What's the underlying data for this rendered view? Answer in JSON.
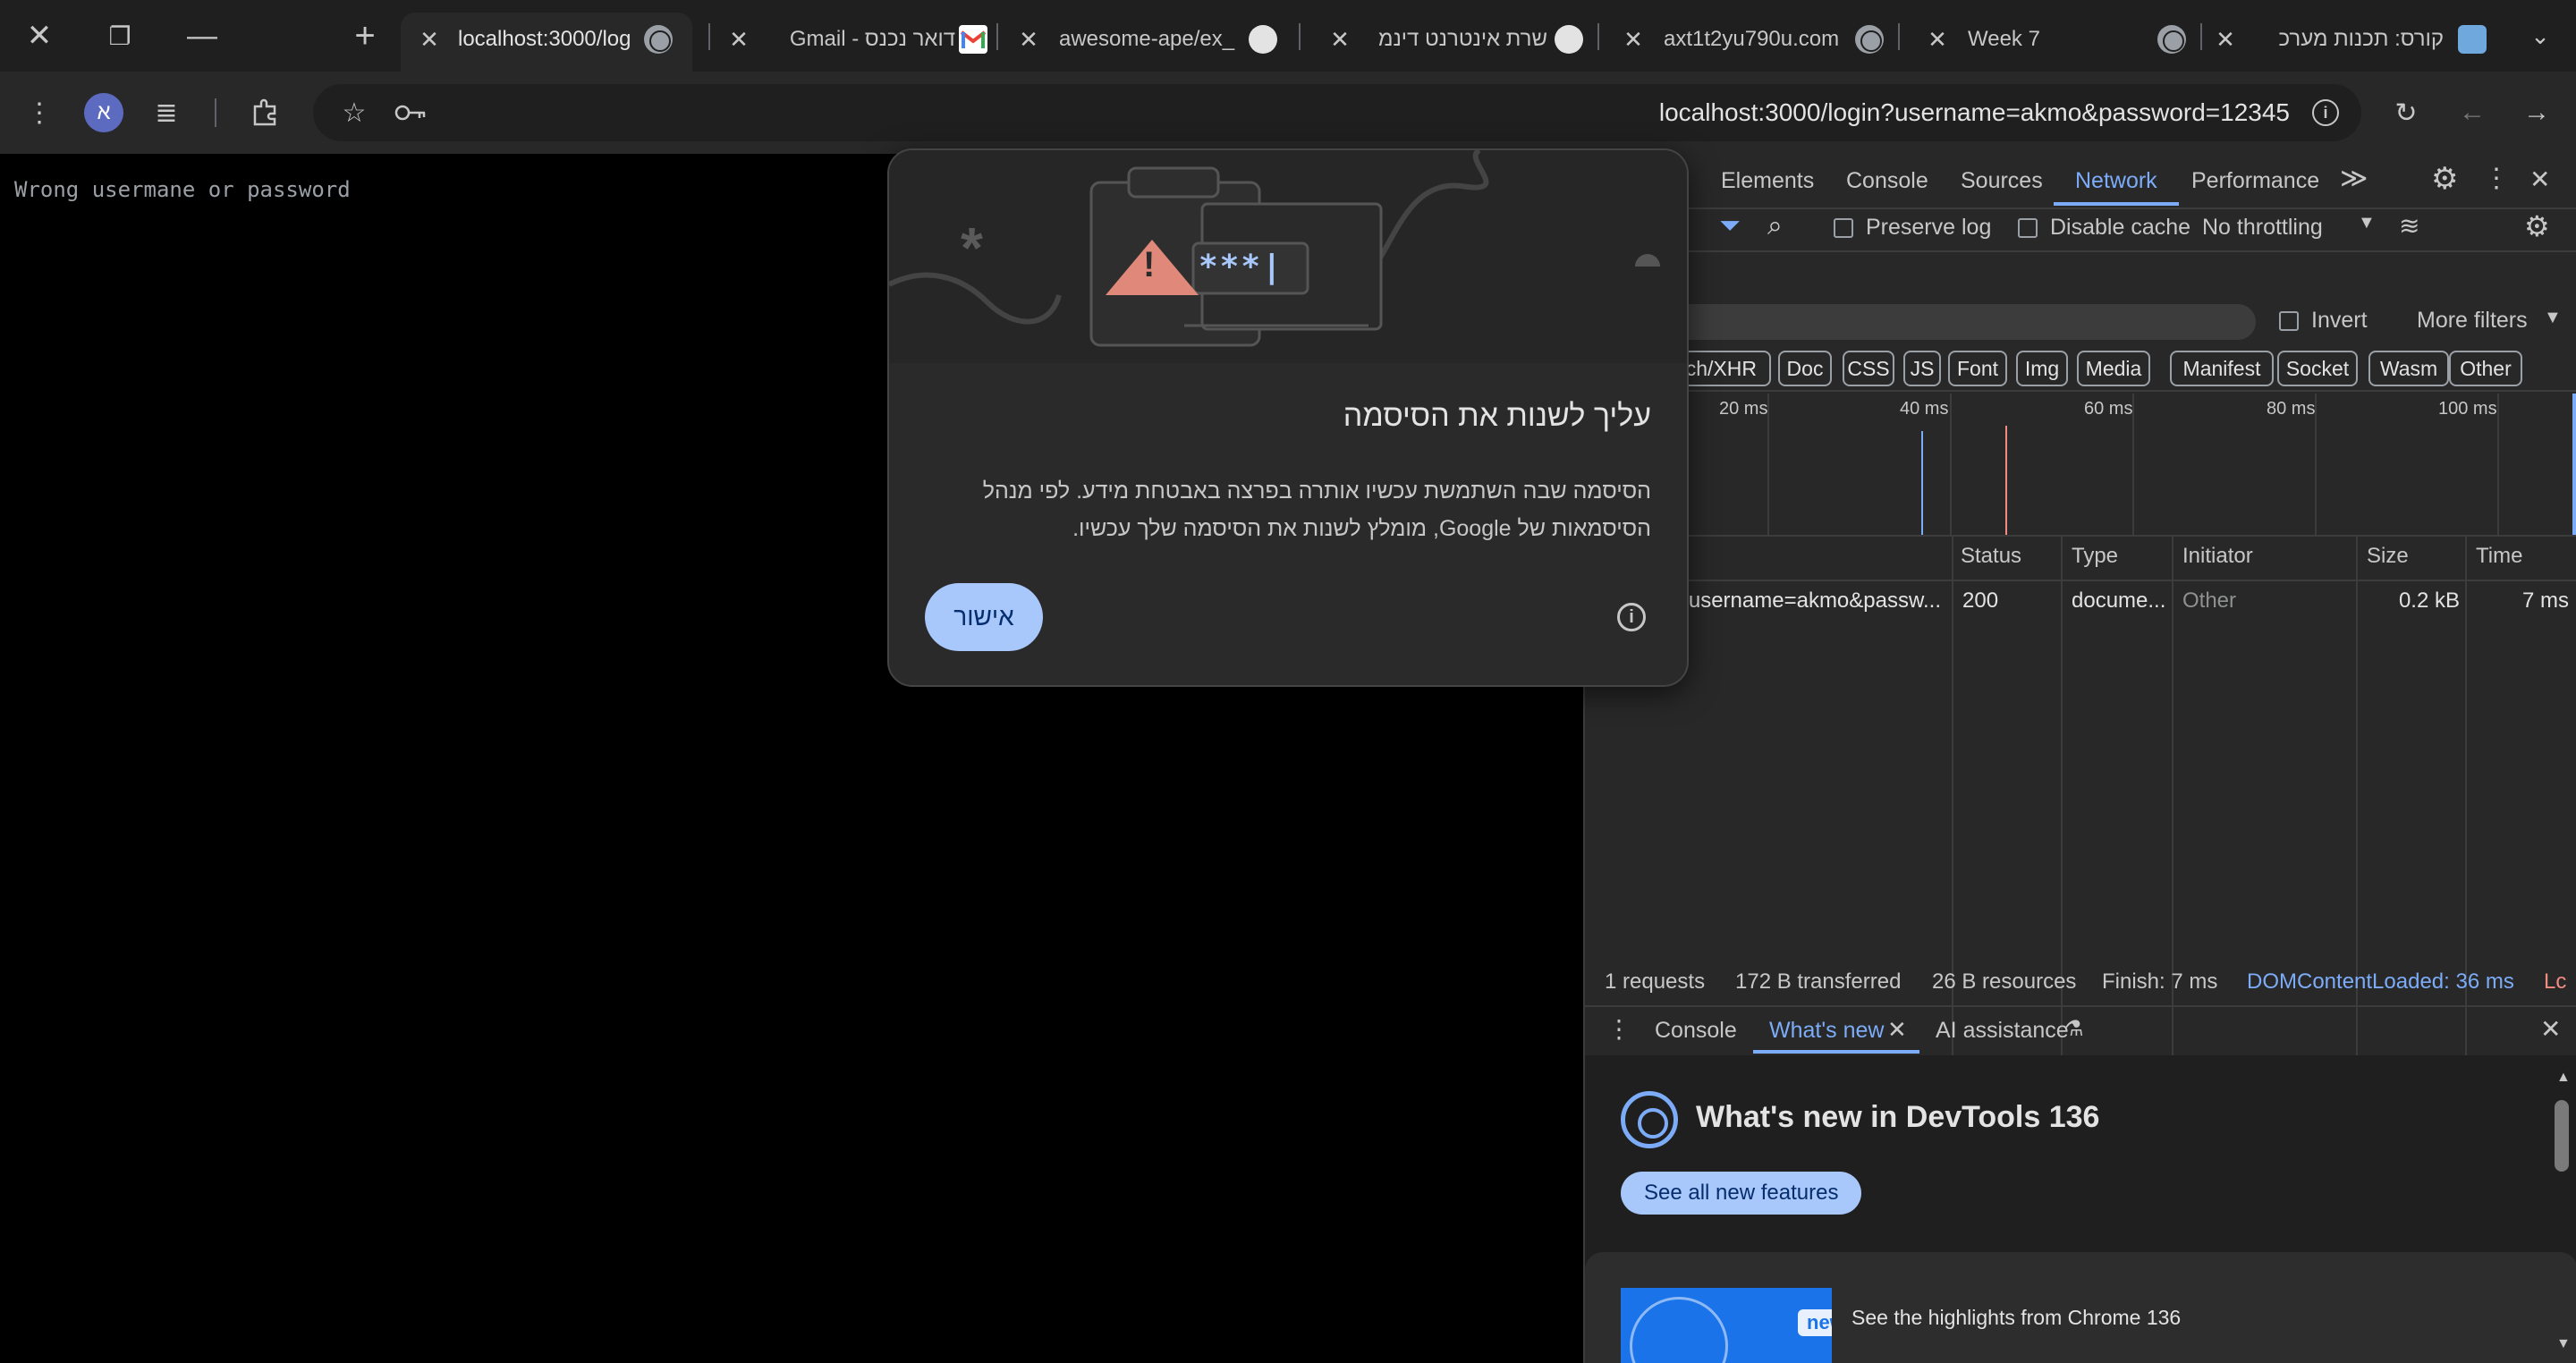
{
  "window": {
    "close_glyph": "✕",
    "restore_glyph": "❐",
    "minimize_glyph": "—",
    "new_tab_glyph": "+"
  },
  "tabs": [
    {
      "title": "localhost:3000/log",
      "icon": "globe-icon",
      "active": true
    },
    {
      "title": "דואר נכנס - Gmail",
      "icon": "gmail-icon"
    },
    {
      "title": "awesome-ape/ex_",
      "icon": "github-icon"
    },
    {
      "title": "שרת אינטרנט דינמ",
      "icon": "chatgpt-icon"
    },
    {
      "title": "axt1t2yu790u.com",
      "icon": "globe-icon"
    },
    {
      "title": "Week 7",
      "icon": "globe-icon"
    },
    {
      "title": "קורס: תכנות מערכ",
      "icon": "course-icon"
    }
  ],
  "toolbar": {
    "avatar_letter": "א",
    "url": "localhost:3000/login?username=akmo&password=12345"
  },
  "page": {
    "error_message": "Wrong usermane or password"
  },
  "dialog": {
    "title": "עליך לשנות את הסיסמה",
    "body": "הסיסמה שבה השתמשת עכשיו אותרה בפרצה באבטחת מידע. לפי מנהל הסיסמאות של Google, מומלץ לשנות את הסיסמה שלך עכשיו.",
    "ok_label": "אישור",
    "illus_password": "***|",
    "illus_warning": "!",
    "illus_star": "*"
  },
  "devtools": {
    "tabs": [
      "Elements",
      "Console",
      "Sources",
      "Network",
      "Performance"
    ],
    "active_tab": "Network",
    "more_tabs_glyph": "≫",
    "close_glyph": "✕",
    "controls": {
      "preserve_log": "Preserve log",
      "disable_cache": "Disable cache",
      "throttling": "No throttling",
      "invert": "Invert",
      "more_filters": "More filters"
    },
    "filter_chips": [
      "Fetch/XHR",
      "Doc",
      "CSS",
      "JS",
      "Font",
      "Img",
      "Media",
      "Manifest",
      "Socket",
      "Wasm",
      "Other"
    ],
    "timeline_labels": [
      "20 ms",
      "40 ms",
      "60 ms",
      "80 ms",
      "100 ms"
    ],
    "columns": [
      "Status",
      "Type",
      "Initiator",
      "Size",
      "Time"
    ],
    "row": {
      "name": "login?username=akmo&passw...",
      "status": "200",
      "type": "docume...",
      "initiator": "Other",
      "size": "0.2 kB",
      "time": "7 ms"
    },
    "status_bar": [
      "1 requests",
      "172 B transferred",
      "26 B resources",
      "Finish: 7 ms",
      "DOMContentLoaded: 36 ms",
      "Lc"
    ],
    "drawer_tabs": [
      "Console",
      "What's new",
      "AI assistance"
    ],
    "drawer_active": "What's new",
    "whats_new": {
      "title": "What's new in DevTools 136",
      "button": "See all new features",
      "badge": "new",
      "card_text": "See the highlights from Chrome 136"
    }
  },
  "colors": {
    "accent": "#7cacf8",
    "button_bg": "#a8c7fa",
    "page_bg": "#000000"
  }
}
